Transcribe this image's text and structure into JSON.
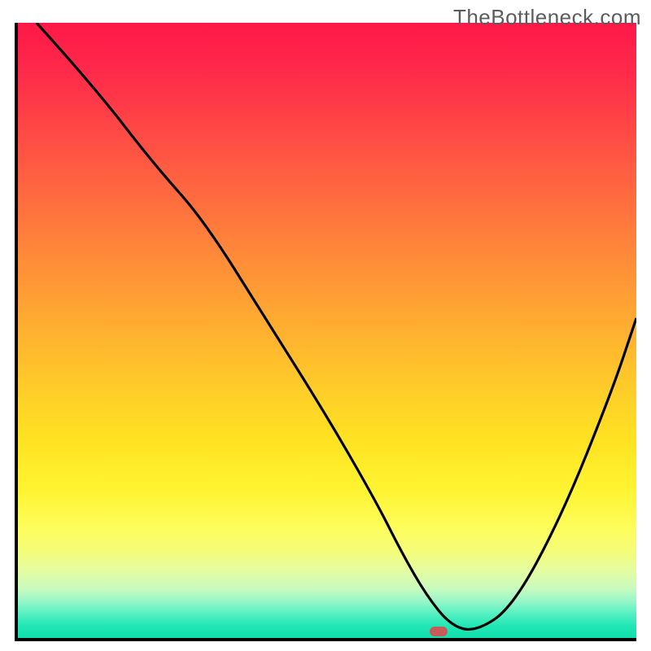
{
  "watermark": "TheBottleneck.com",
  "chart_data": {
    "type": "line",
    "title": "",
    "xlabel": "",
    "ylabel": "",
    "xlim": [
      0,
      100
    ],
    "ylim": [
      0,
      100
    ],
    "grid": false,
    "legend": false,
    "series": [
      {
        "name": "curve",
        "x": [
          3,
          12,
          22,
          30,
          40,
          50,
          58,
          62,
          66,
          70,
          74,
          80,
          88,
          96,
          100
        ],
        "y": [
          100,
          90,
          77,
          68,
          52,
          36,
          22,
          14,
          7,
          2,
          1,
          5,
          20,
          40,
          52
        ]
      }
    ],
    "marker": {
      "x": 68,
      "y": 1
    },
    "colors": {
      "line": "#000000",
      "marker": "#c85a5a"
    }
  }
}
